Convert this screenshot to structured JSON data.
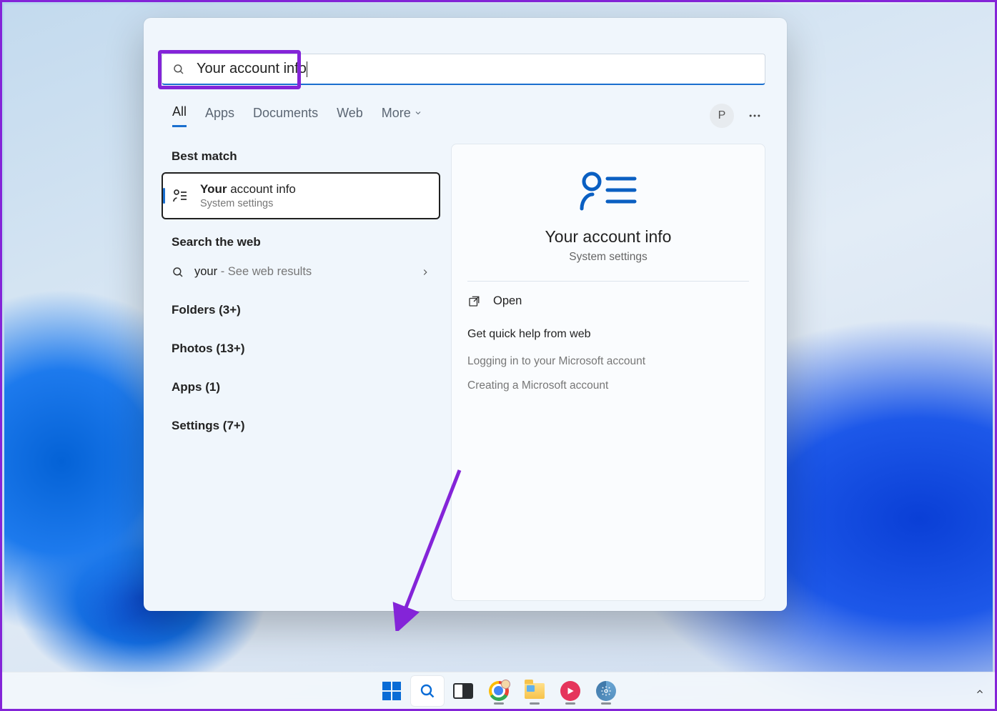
{
  "search": {
    "query": "Your account info"
  },
  "tabs": {
    "items": [
      "All",
      "Apps",
      "Documents",
      "Web",
      "More"
    ],
    "active_index": 0,
    "avatar_initial": "P"
  },
  "left": {
    "best_match_heading": "Best match",
    "best_match": {
      "title_bold": "Your",
      "title_rest": " account info",
      "subtitle": "System settings"
    },
    "search_web_heading": "Search the web",
    "web_result": {
      "term": "your",
      "suffix": " - See web results"
    },
    "categories": [
      "Folders (3+)",
      "Photos (13+)",
      "Apps (1)",
      "Settings (7+)"
    ]
  },
  "right": {
    "title": "Your account info",
    "subtitle": "System settings",
    "open_label": "Open",
    "help_heading": "Get quick help from web",
    "help_links": [
      "Logging in to your Microsoft account",
      "Creating a Microsoft account"
    ]
  },
  "taskbar": {
    "items": [
      {
        "name": "start",
        "running": false
      },
      {
        "name": "search",
        "running": false,
        "active": true
      },
      {
        "name": "task-view",
        "running": false
      },
      {
        "name": "chrome",
        "running": true
      },
      {
        "name": "file-explorer",
        "running": true
      },
      {
        "name": "media-app",
        "running": true
      },
      {
        "name": "settings",
        "running": true
      }
    ]
  }
}
